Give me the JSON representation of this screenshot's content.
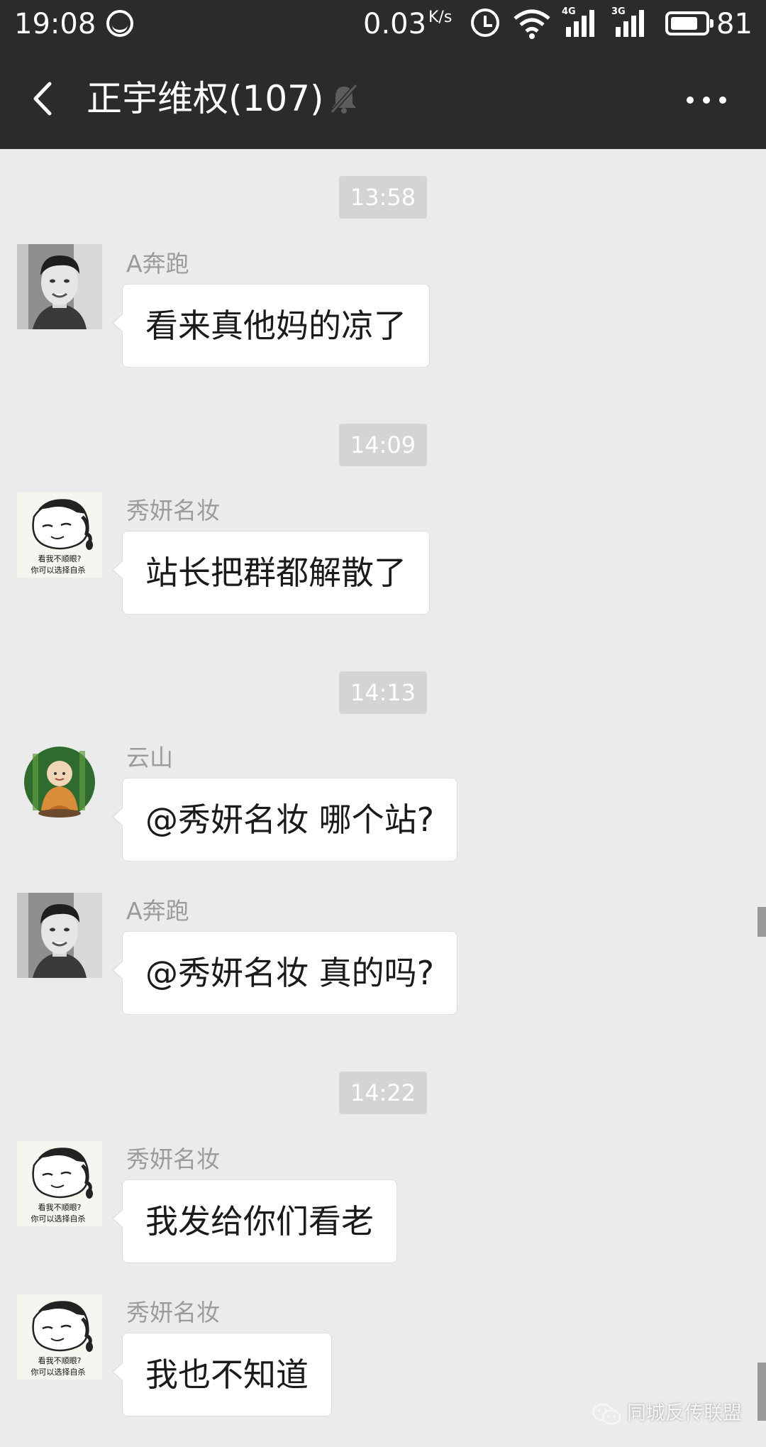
{
  "status_bar": {
    "time": "19:08",
    "network_speed": "0.03",
    "speed_unit": "K/s",
    "signal_1_type": "4G",
    "signal_2_type": "3G",
    "battery_level": "81",
    "battery_fraction": 0.81
  },
  "header": {
    "title": "正宇维权(107)",
    "back_icon": "chevron-left-icon",
    "mute_icon": "bell-off-icon",
    "more_icon": "more-horizontal-icon"
  },
  "messages": [
    {
      "type": "time",
      "text": "13:58"
    },
    {
      "type": "msg",
      "sender": "A奔跑",
      "avatar": "man-photo",
      "text": "看来真他妈的凉了"
    },
    {
      "type": "time",
      "text": "14:09"
    },
    {
      "type": "msg",
      "sender": "秀妍名妆",
      "avatar": "cartoon-sticker",
      "avatar_caption": "看我不顺眼?\n你可以选择自杀",
      "text": "站长把群都解散了"
    },
    {
      "type": "time",
      "text": "14:13"
    },
    {
      "type": "msg",
      "sender": "云山",
      "avatar": "monk-figure",
      "text": "@秀妍名妆  哪个站?"
    },
    {
      "type": "msg",
      "sender": "A奔跑",
      "avatar": "man-photo",
      "text": "@秀妍名妆  真的吗?"
    },
    {
      "type": "time",
      "text": "14:22"
    },
    {
      "type": "msg",
      "sender": "秀妍名妆",
      "avatar": "cartoon-sticker",
      "avatar_caption": "看我不顺眼?\n你可以选择自杀",
      "text": "我发给你们看老"
    },
    {
      "type": "msg",
      "sender": "秀妍名妆",
      "avatar": "cartoon-sticker",
      "avatar_caption": "看我不顺眼?\n你可以选择自杀",
      "text": "我也不知道"
    }
  ],
  "avatar_caption_lines": [
    "看我不顺眼?",
    "你可以选择自杀"
  ],
  "watermark": {
    "text": "同城反传联盟",
    "icon": "wechat-icon"
  },
  "colors": {
    "top_bar": "#2b2b2b",
    "chat_background": "#ebebeb",
    "bubble": "#ffffff",
    "timestamp_bg": "#d4d4d4",
    "sender_name": "#9c9c9c"
  }
}
